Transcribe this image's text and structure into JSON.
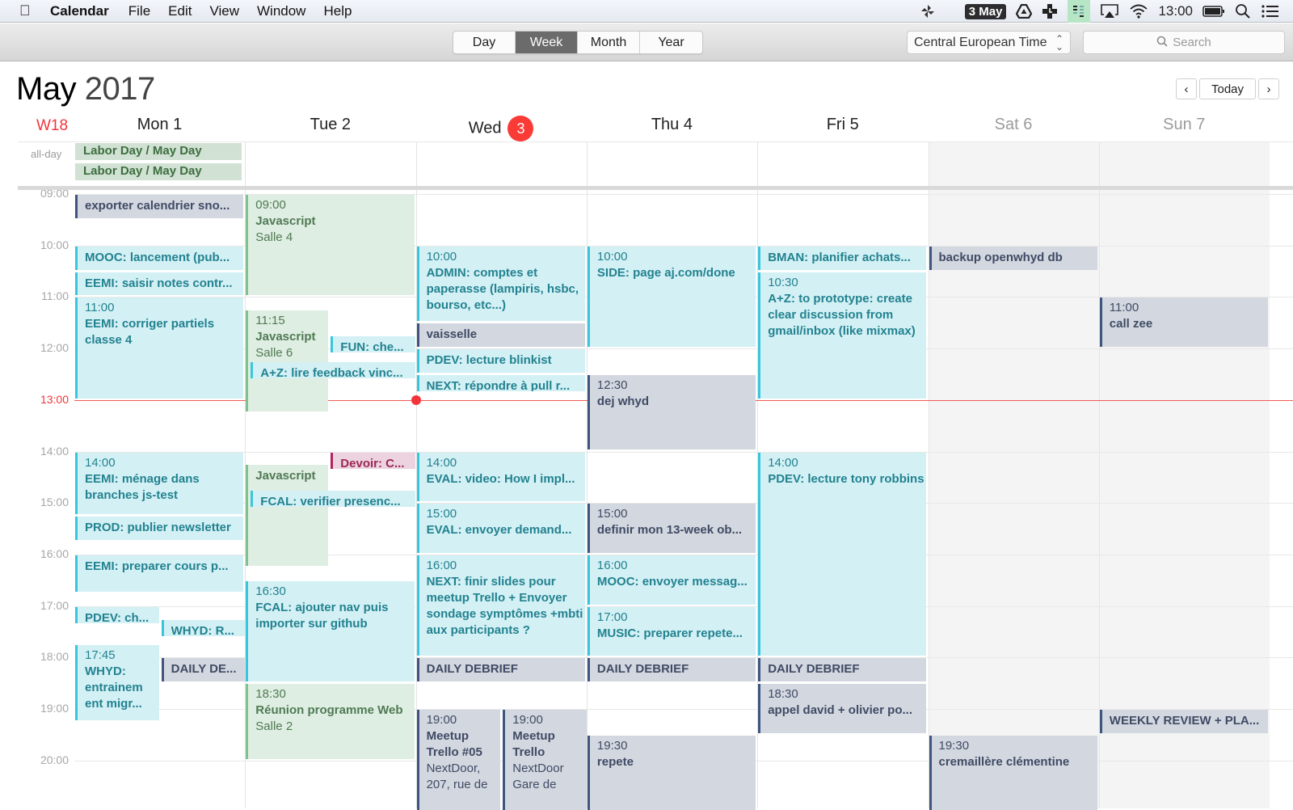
{
  "menubar": {
    "app_name": "Calendar",
    "menus": [
      "File",
      "Edit",
      "View",
      "Window",
      "Help"
    ],
    "status": {
      "date_badge": "3 May",
      "clock": "13:00",
      "icons": [
        "pinwheel-icon",
        "google-drive-icon",
        "plus-cross-icon",
        "menu-meters-icon",
        "airplay-icon",
        "wifi-icon",
        "battery-icon",
        "spotlight-search-icon",
        "notification-center-icon"
      ]
    }
  },
  "toolbar": {
    "views": [
      {
        "label": "Day",
        "active": false
      },
      {
        "label": "Week",
        "active": true
      },
      {
        "label": "Month",
        "active": false
      },
      {
        "label": "Year",
        "active": false
      }
    ],
    "timezone": "Central European Time",
    "search_placeholder": "Search"
  },
  "header": {
    "month": "May",
    "year": "2017",
    "today_label": "Today",
    "prev_label": "‹",
    "next_label": "›",
    "week_number": "W18",
    "allday_label": "all-day"
  },
  "days": [
    {
      "name": "Mon 1",
      "weekend": false
    },
    {
      "name": "Tue 2",
      "weekend": false
    },
    {
      "name": "Wed",
      "badge": "3",
      "weekend": false,
      "today": true
    },
    {
      "name": "Thu 4",
      "weekend": false
    },
    {
      "name": "Fri 5",
      "weekend": false
    },
    {
      "name": "Sat 6",
      "weekend": true
    },
    {
      "name": "Sun 7",
      "weekend": true
    }
  ],
  "hours": [
    "09:00",
    "10:00",
    "11:00",
    "12:00",
    "13:00",
    "14:00",
    "15:00",
    "16:00",
    "17:00",
    "18:00",
    "19:00",
    "20:00"
  ],
  "current_time": "13:00",
  "colors": {
    "teal": "#38c6dc",
    "gray": "#3e5580",
    "green": "#7fc28b",
    "pink": "#b2235d",
    "today_red": "#fa3a35"
  },
  "allday_events": [
    {
      "day": 0,
      "title": "Labor Day / May Day"
    },
    {
      "day": 0,
      "title": "Labor Day / May Day"
    }
  ],
  "events": [
    {
      "day": 0,
      "start": 9.0,
      "end": 9.5,
      "title": "exporter calendrier sno...",
      "color": "gray",
      "single": true
    },
    {
      "day": 0,
      "start": 10.0,
      "end": 10.5,
      "title": "MOOC: lancement (pub...",
      "color": "teal",
      "single": true
    },
    {
      "day": 0,
      "start": 10.5,
      "end": 11.0,
      "title": "EEMI: saisir notes contr...",
      "color": "teal",
      "single": true
    },
    {
      "day": 0,
      "start": 11.0,
      "end": 13.0,
      "time": "11:00",
      "title": "EEMI: corriger partiels classe 4",
      "color": "teal"
    },
    {
      "day": 0,
      "start": 14.0,
      "end": 15.25,
      "time": "14:00",
      "title": "EEMI: ménage dans branches js-test",
      "color": "teal"
    },
    {
      "day": 0,
      "start": 15.25,
      "end": 15.75,
      "title": "PROD: publier newsletter",
      "color": "teal",
      "single": true
    },
    {
      "day": 0,
      "start": 16.0,
      "end": 16.75,
      "title": "EEMI: preparer cours p...",
      "color": "teal",
      "single": true
    },
    {
      "day": 0,
      "start": 17.0,
      "end": 17.33,
      "title": "PDEV: ch...",
      "color": "teal",
      "single": true,
      "slot": 0,
      "slots": 2
    },
    {
      "day": 0,
      "start": 17.25,
      "end": 17.58,
      "title": "WHYD: R...",
      "color": "teal",
      "single": true,
      "slot": 1,
      "slots": 2
    },
    {
      "day": 0,
      "start": 17.75,
      "end": 19.25,
      "time": "17:45",
      "title": "WHYD: entrainem ent migr...",
      "color": "teal",
      "slot": 0,
      "slots": 2
    },
    {
      "day": 0,
      "start": 18.0,
      "end": 18.5,
      "title": "DAILY DE...",
      "color": "gray",
      "single": true,
      "slot": 1,
      "slots": 2
    },
    {
      "day": 1,
      "start": 9.0,
      "end": 11.0,
      "time": "09:00",
      "title": "Javascript",
      "location": "Salle 4",
      "color": "green"
    },
    {
      "day": 1,
      "start": 11.25,
      "end": 13.25,
      "time": "11:15",
      "title": "Javascript",
      "location": "Salle 6",
      "color": "green",
      "slot": 0,
      "slots": 2
    },
    {
      "day": 1,
      "start": 11.75,
      "end": 12.08,
      "title": "FUN: che...",
      "color": "teal",
      "single": true,
      "slot": 1,
      "slots": 2
    },
    {
      "day": 1,
      "start": 12.25,
      "end": 12.58,
      "title": "A+Z: lire feedback vinc...",
      "color": "teal",
      "single": true,
      "wide": true
    },
    {
      "day": 1,
      "start": 14.0,
      "end": 14.33,
      "title": "Devoir: C...",
      "color": "pink",
      "single": true,
      "slot": 1,
      "slots": 2
    },
    {
      "day": 1,
      "start": 14.25,
      "end": 16.25,
      "title": "Javascript",
      "color": "green",
      "single": true,
      "slot": 0,
      "slots": 2
    },
    {
      "day": 1,
      "start": 14.75,
      "end": 15.08,
      "title": "FCAL: verifier presenc...",
      "color": "teal",
      "single": true,
      "wide": true
    },
    {
      "day": 1,
      "start": 16.5,
      "end": 18.5,
      "time": "16:30",
      "title": "FCAL: ajouter nav puis importer sur github",
      "color": "teal"
    },
    {
      "day": 1,
      "start": 18.5,
      "end": 20.0,
      "time": "18:30",
      "title": "Réunion programme Web",
      "location": "Salle 2",
      "color": "green"
    },
    {
      "day": 2,
      "start": 10.0,
      "end": 11.5,
      "time": "10:00",
      "title": "ADMIN: comptes et paperasse (lampiris, hsbc, bourso, etc...)",
      "color": "teal"
    },
    {
      "day": 2,
      "start": 11.5,
      "end": 12.0,
      "title": "vaisselle",
      "color": "gray",
      "single": true
    },
    {
      "day": 2,
      "start": 12.0,
      "end": 12.5,
      "title": "PDEV: lecture blinkist",
      "color": "teal",
      "single": true
    },
    {
      "day": 2,
      "start": 12.5,
      "end": 12.83,
      "title": "NEXT: répondre à pull r...",
      "color": "teal",
      "single": true
    },
    {
      "day": 2,
      "start": 14.0,
      "end": 15.0,
      "time": "14:00",
      "title": "EVAL: video: How I impl...",
      "color": "teal",
      "single": true
    },
    {
      "day": 2,
      "start": 15.0,
      "end": 16.0,
      "time": "15:00",
      "title": "EVAL: envoyer demand...",
      "color": "teal",
      "single": true
    },
    {
      "day": 2,
      "start": 16.0,
      "end": 18.0,
      "time": "16:00",
      "title": "NEXT: finir slides pour meetup Trello + Envoyer sondage symptômes +mbti aux participants ?",
      "color": "teal"
    },
    {
      "day": 2,
      "start": 18.0,
      "end": 18.5,
      "title": "DAILY DEBRIEF",
      "color": "gray",
      "single": true
    },
    {
      "day": 2,
      "start": 19.0,
      "end": 21.0,
      "time": "19:00",
      "title": "Meetup Trello #05",
      "location": "NextDoor, 207, rue de",
      "color": "gray",
      "slot": 0,
      "slots": 2
    },
    {
      "day": 2,
      "start": 19.0,
      "end": 21.0,
      "time": "19:00",
      "title": "Meetup Trello",
      "location": "NextDoor Gare de",
      "color": "gray",
      "slot": 1,
      "slots": 2
    },
    {
      "day": 3,
      "start": 10.0,
      "end": 12.0,
      "time": "10:00",
      "title": "SIDE: page aj.com/done",
      "color": "teal"
    },
    {
      "day": 3,
      "start": 12.5,
      "end": 14.0,
      "time": "12:30",
      "title": "dej whyd",
      "color": "gray"
    },
    {
      "day": 3,
      "start": 15.0,
      "end": 16.0,
      "time": "15:00",
      "title": "definir mon 13-week ob...",
      "color": "gray",
      "single": true
    },
    {
      "day": 3,
      "start": 16.0,
      "end": 17.0,
      "time": "16:00",
      "title": "MOOC: envoyer messag...",
      "color": "teal",
      "single": true
    },
    {
      "day": 3,
      "start": 17.0,
      "end": 18.0,
      "time": "17:00",
      "title": "MUSIC: preparer repete...",
      "color": "teal",
      "single": true
    },
    {
      "day": 3,
      "start": 18.0,
      "end": 18.5,
      "title": "DAILY DEBRIEF",
      "color": "gray",
      "single": true
    },
    {
      "day": 3,
      "start": 19.5,
      "end": 21.0,
      "time": "19:30",
      "title": "repete",
      "color": "gray"
    },
    {
      "day": 4,
      "start": 10.0,
      "end": 10.5,
      "title": "BMAN: planifier achats...",
      "color": "teal",
      "single": true
    },
    {
      "day": 4,
      "start": 10.5,
      "end": 13.0,
      "time": "10:30",
      "title": "A+Z: to prototype: create clear discussion from gmail/inbox (like mixmax)",
      "color": "teal"
    },
    {
      "day": 4,
      "start": 14.0,
      "end": 18.0,
      "time": "14:00",
      "title": "PDEV: lecture tony robbins",
      "color": "teal"
    },
    {
      "day": 4,
      "start": 18.0,
      "end": 18.5,
      "title": "DAILY DEBRIEF",
      "color": "gray",
      "single": true
    },
    {
      "day": 4,
      "start": 18.5,
      "end": 19.5,
      "time": "18:30",
      "title": "appel david + olivier po...",
      "color": "gray",
      "single": true
    },
    {
      "day": 5,
      "start": 10.0,
      "end": 10.5,
      "title": "backup openwhyd db",
      "color": "gray",
      "single": true
    },
    {
      "day": 5,
      "start": 19.5,
      "end": 21.0,
      "time": "19:30",
      "title": "cremaillère clémentine",
      "color": "gray"
    },
    {
      "day": 6,
      "start": 11.0,
      "end": 12.0,
      "time": "11:00",
      "title": "call zee",
      "color": "gray"
    },
    {
      "day": 6,
      "start": 19.0,
      "end": 19.5,
      "title": "WEEKLY REVIEW + PLA...",
      "color": "gray",
      "single": true
    }
  ]
}
